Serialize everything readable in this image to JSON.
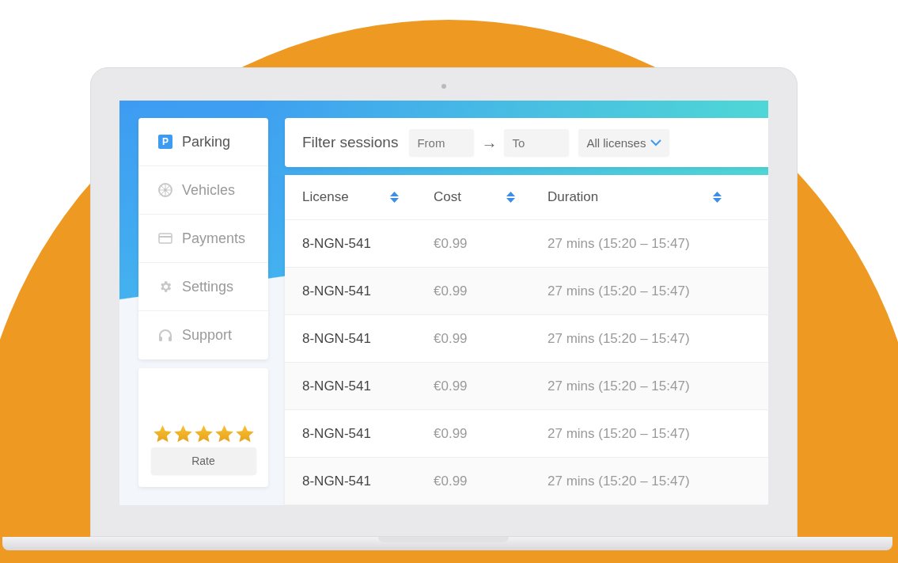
{
  "sidebar": {
    "items": [
      {
        "label": "Parking",
        "badge": "P",
        "selected": true
      },
      {
        "label": "Vehicles",
        "selected": false
      },
      {
        "label": "Payments",
        "selected": false
      },
      {
        "label": "Settings",
        "selected": false
      },
      {
        "label": "Support",
        "selected": false
      }
    ]
  },
  "rating": {
    "stars": 5,
    "button": "Rate"
  },
  "filter": {
    "title": "Filter sessions",
    "from": {
      "placeholder": "From"
    },
    "arrow": "→",
    "to": {
      "placeholder": "To"
    },
    "licenses": "All licenses"
  },
  "table": {
    "columns": [
      "License",
      "Cost",
      "Duration"
    ],
    "rows": [
      [
        "8-NGN-541",
        "€0.99",
        "27 mins (15:20 – 15:47)"
      ],
      [
        "8-NGN-541",
        "€0.99",
        "27 mins (15:20 – 15:47)"
      ],
      [
        "8-NGN-541",
        "€0.99",
        "27 mins (15:20 – 15:47)"
      ],
      [
        "8-NGN-541",
        "€0.99",
        "27 mins (15:20 – 15:47)"
      ],
      [
        "8-NGN-541",
        "€0.99",
        "27 mins (15:20 – 15:47)"
      ],
      [
        "8-NGN-541",
        "€0.99",
        "27 mins (15:20 – 15:47)"
      ]
    ]
  }
}
